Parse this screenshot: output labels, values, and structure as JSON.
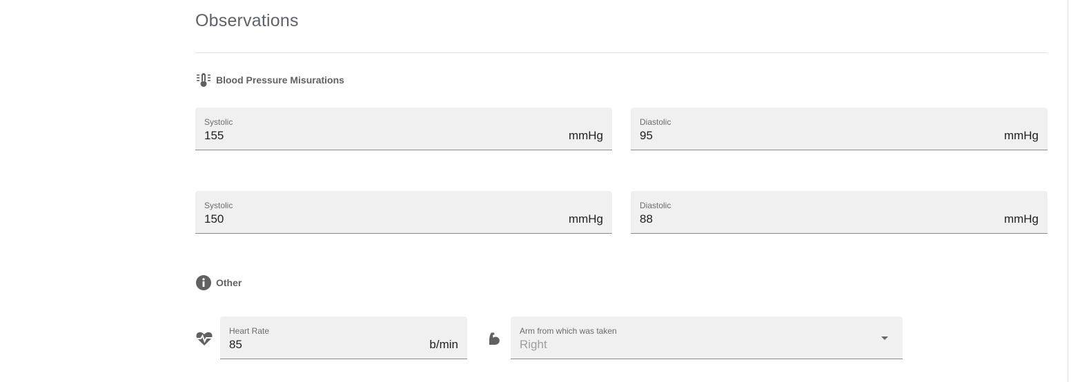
{
  "page": {
    "title": "Observations"
  },
  "blood_pressure": {
    "header_label": "Blood Pressure Misurations",
    "header_icon": "thermometer-icon",
    "readings": [
      {
        "systolic": {
          "label": "Systolic",
          "value": "155",
          "unit": "mmHg"
        },
        "diastolic": {
          "label": "Diastolic",
          "value": "95",
          "unit": "mmHg"
        }
      },
      {
        "systolic": {
          "label": "Systolic",
          "value": "150",
          "unit": "mmHg"
        },
        "diastolic": {
          "label": "Diastolic",
          "value": "88",
          "unit": "mmHg"
        }
      }
    ]
  },
  "other": {
    "header_label": "Other",
    "header_icon": "info-icon",
    "heart_rate": {
      "label": "Heart Rate",
      "value": "85",
      "unit": "b/min",
      "icon": "heart-pulse-icon"
    },
    "arm": {
      "label": "Arm from which was taken",
      "selected": "Right",
      "icon": "arm-icon"
    }
  },
  "colors": {
    "field_background": "#f0f0f0",
    "icon": "#616161",
    "title": "#5f6368"
  }
}
